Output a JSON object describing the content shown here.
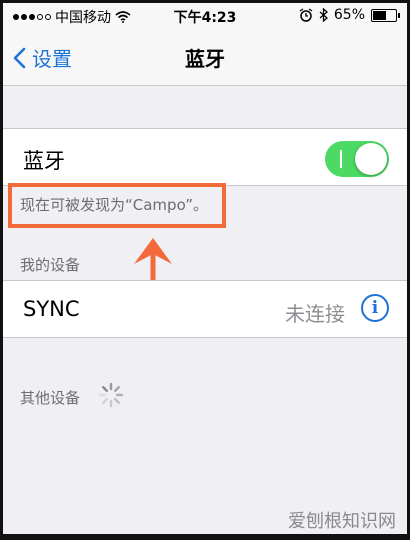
{
  "status_bar": {
    "carrier": "中国移动",
    "time": "下午4:23",
    "battery_percent": "65%",
    "battery_level": 0.65
  },
  "nav": {
    "back_label": "设置",
    "title": "蓝牙"
  },
  "bluetooth": {
    "label": "蓝牙",
    "enabled": true,
    "discoverable_text": "现在可被发现为“Campo”。"
  },
  "my_devices": {
    "header": "我的设备",
    "items": [
      {
        "name": "SYNC",
        "status": "未连接"
      }
    ]
  },
  "other_devices": {
    "header": "其他设备"
  },
  "watermark": "爱刨根知识网",
  "colors": {
    "accent": "#1e74d6",
    "toggle_on": "#4cd964",
    "annotation": "#f26a3a"
  }
}
